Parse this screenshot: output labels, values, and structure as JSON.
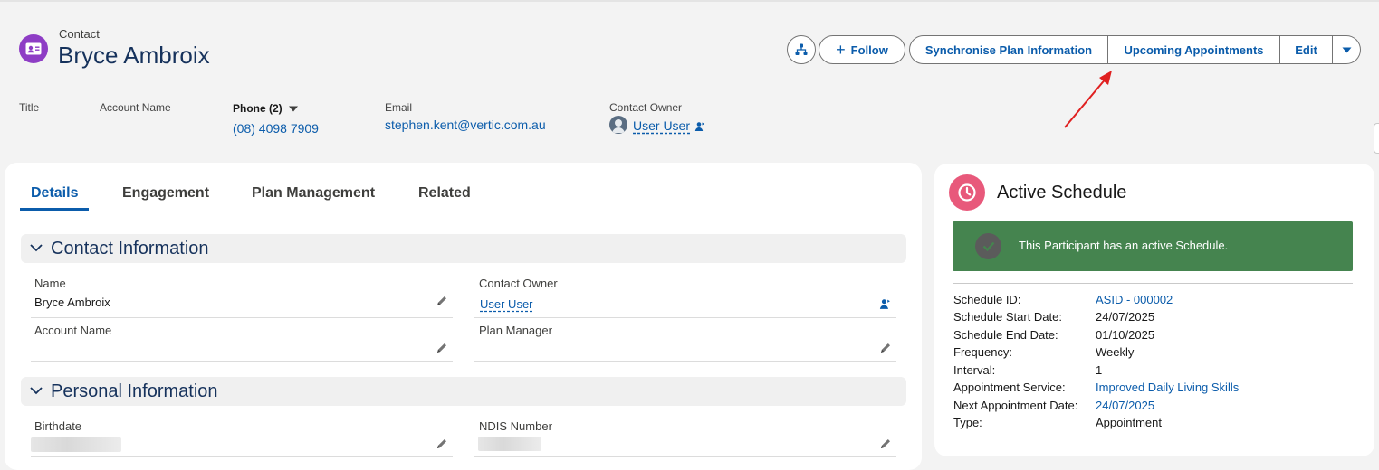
{
  "header": {
    "object_type": "Contact",
    "record_name": "Bryce Ambroix",
    "fields": {
      "title_label": "Title",
      "account_label": "Account Name",
      "phone_label": "Phone (2)",
      "phone_value": "(08) 4098 7909",
      "email_label": "Email",
      "email_value": "stephen.kent@vertic.com.au",
      "owner_label": "Contact Owner",
      "owner_value": "User User"
    },
    "actions": {
      "follow": "Follow",
      "sync": "Synchronise Plan Information",
      "upcoming": "Upcoming Appointments",
      "edit": "Edit"
    }
  },
  "tabs": [
    "Details",
    "Engagement",
    "Plan Management",
    "Related"
  ],
  "sections": {
    "contact_info": {
      "title": "Contact Information",
      "name_label": "Name",
      "name_value": "Bryce Ambroix",
      "owner_label": "Contact Owner",
      "owner_value": "User User",
      "account_label": "Account Name",
      "plan_manager_label": "Plan Manager"
    },
    "personal_info": {
      "title": "Personal Information",
      "birthdate_label": "Birthdate",
      "ndis_label": "NDIS Number"
    }
  },
  "schedule": {
    "title": "Active Schedule",
    "banner": "This Participant has an active Schedule.",
    "rows": [
      {
        "label": "Schedule ID:",
        "value": "ASID - 000002"
      },
      {
        "label": "Schedule Start Date:",
        "value": "24/07/2025"
      },
      {
        "label": "Schedule End Date:",
        "value": "01/10/2025"
      },
      {
        "label": "Frequency:",
        "value": "Weekly"
      },
      {
        "label": "Interval:",
        "value": "1"
      },
      {
        "label": "Appointment Service:",
        "value": "Improved Daily Living Skills"
      },
      {
        "label": "Next Appointment Date:",
        "value": "24/07/2025"
      },
      {
        "label": "Type:",
        "value": "Appointment"
      }
    ]
  },
  "colors": {
    "brand_blue": "#0b5cab",
    "contact_icon": "#8e3dc5",
    "schedule_icon": "#e8597b",
    "banner_green": "#45844f",
    "annotation_arrow": "#e02020"
  }
}
